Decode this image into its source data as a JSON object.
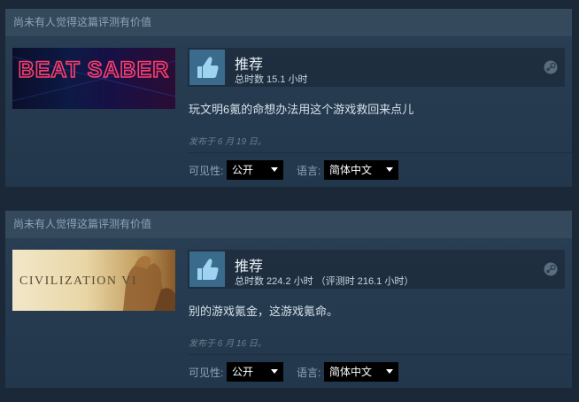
{
  "reviews": [
    {
      "helpful_text": "尚未有人觉得这篇评测有价值",
      "game_logo": "BEAT SABER",
      "vote": "推荐",
      "hours": "总时数 15.1 小时",
      "review_text": "玩文明6氪的命想办法用这个游戏救回来点儿",
      "posted": "发布于 6 月 19 日。",
      "visibility_label": "可见性:",
      "visibility_value": "公开",
      "language_label": "语言:",
      "language_value": "简体中文",
      "icons": [
        "thumbs-up-icon",
        "steam-icon",
        "chevron-down-icon"
      ]
    },
    {
      "helpful_text": "尚未有人觉得这篇评测有价值",
      "game_logo": "CIVILIZATION VI",
      "vote": "推荐",
      "hours": "总时数 224.2 小时 （评测时 216.1 小时）",
      "review_text": "别的游戏氪金，这游戏氪命。",
      "posted": "发布于 6 月 16 日。",
      "visibility_label": "可见性:",
      "visibility_value": "公开",
      "language_label": "语言:",
      "language_value": "简体中文",
      "icons": [
        "thumbs-up-icon",
        "steam-icon",
        "chevron-down-icon"
      ]
    }
  ],
  "colors": {
    "background": "#1b2838",
    "card": "#2a3f55",
    "thumb_blue": "#3a6b8c",
    "accent_text": "#e8eef3"
  }
}
